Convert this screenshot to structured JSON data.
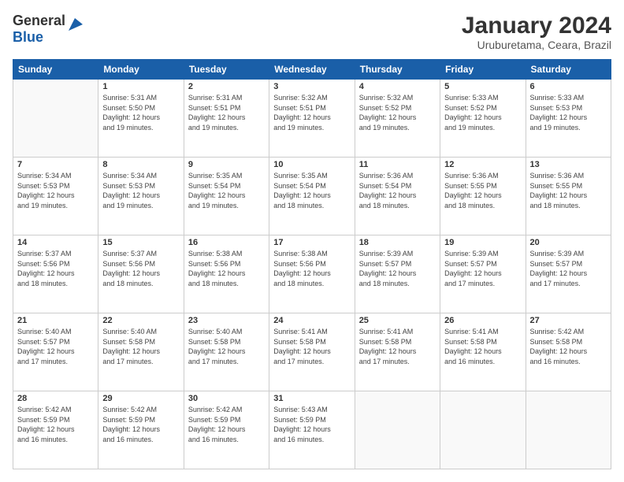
{
  "logo": {
    "line1": "General",
    "line2": "Blue"
  },
  "title": "January 2024",
  "subtitle": "Uruburetama, Ceara, Brazil",
  "weekdays": [
    "Sunday",
    "Monday",
    "Tuesday",
    "Wednesday",
    "Thursday",
    "Friday",
    "Saturday"
  ],
  "weeks": [
    [
      {
        "day": "",
        "info": ""
      },
      {
        "day": "1",
        "info": "Sunrise: 5:31 AM\nSunset: 5:50 PM\nDaylight: 12 hours\nand 19 minutes."
      },
      {
        "day": "2",
        "info": "Sunrise: 5:31 AM\nSunset: 5:51 PM\nDaylight: 12 hours\nand 19 minutes."
      },
      {
        "day": "3",
        "info": "Sunrise: 5:32 AM\nSunset: 5:51 PM\nDaylight: 12 hours\nand 19 minutes."
      },
      {
        "day": "4",
        "info": "Sunrise: 5:32 AM\nSunset: 5:52 PM\nDaylight: 12 hours\nand 19 minutes."
      },
      {
        "day": "5",
        "info": "Sunrise: 5:33 AM\nSunset: 5:52 PM\nDaylight: 12 hours\nand 19 minutes."
      },
      {
        "day": "6",
        "info": "Sunrise: 5:33 AM\nSunset: 5:53 PM\nDaylight: 12 hours\nand 19 minutes."
      }
    ],
    [
      {
        "day": "7",
        "info": "Sunrise: 5:34 AM\nSunset: 5:53 PM\nDaylight: 12 hours\nand 19 minutes."
      },
      {
        "day": "8",
        "info": "Sunrise: 5:34 AM\nSunset: 5:53 PM\nDaylight: 12 hours\nand 19 minutes."
      },
      {
        "day": "9",
        "info": "Sunrise: 5:35 AM\nSunset: 5:54 PM\nDaylight: 12 hours\nand 19 minutes."
      },
      {
        "day": "10",
        "info": "Sunrise: 5:35 AM\nSunset: 5:54 PM\nDaylight: 12 hours\nand 18 minutes."
      },
      {
        "day": "11",
        "info": "Sunrise: 5:36 AM\nSunset: 5:54 PM\nDaylight: 12 hours\nand 18 minutes."
      },
      {
        "day": "12",
        "info": "Sunrise: 5:36 AM\nSunset: 5:55 PM\nDaylight: 12 hours\nand 18 minutes."
      },
      {
        "day": "13",
        "info": "Sunrise: 5:36 AM\nSunset: 5:55 PM\nDaylight: 12 hours\nand 18 minutes."
      }
    ],
    [
      {
        "day": "14",
        "info": "Sunrise: 5:37 AM\nSunset: 5:56 PM\nDaylight: 12 hours\nand 18 minutes."
      },
      {
        "day": "15",
        "info": "Sunrise: 5:37 AM\nSunset: 5:56 PM\nDaylight: 12 hours\nand 18 minutes."
      },
      {
        "day": "16",
        "info": "Sunrise: 5:38 AM\nSunset: 5:56 PM\nDaylight: 12 hours\nand 18 minutes."
      },
      {
        "day": "17",
        "info": "Sunrise: 5:38 AM\nSunset: 5:56 PM\nDaylight: 12 hours\nand 18 minutes."
      },
      {
        "day": "18",
        "info": "Sunrise: 5:39 AM\nSunset: 5:57 PM\nDaylight: 12 hours\nand 18 minutes."
      },
      {
        "day": "19",
        "info": "Sunrise: 5:39 AM\nSunset: 5:57 PM\nDaylight: 12 hours\nand 17 minutes."
      },
      {
        "day": "20",
        "info": "Sunrise: 5:39 AM\nSunset: 5:57 PM\nDaylight: 12 hours\nand 17 minutes."
      }
    ],
    [
      {
        "day": "21",
        "info": "Sunrise: 5:40 AM\nSunset: 5:57 PM\nDaylight: 12 hours\nand 17 minutes."
      },
      {
        "day": "22",
        "info": "Sunrise: 5:40 AM\nSunset: 5:58 PM\nDaylight: 12 hours\nand 17 minutes."
      },
      {
        "day": "23",
        "info": "Sunrise: 5:40 AM\nSunset: 5:58 PM\nDaylight: 12 hours\nand 17 minutes."
      },
      {
        "day": "24",
        "info": "Sunrise: 5:41 AM\nSunset: 5:58 PM\nDaylight: 12 hours\nand 17 minutes."
      },
      {
        "day": "25",
        "info": "Sunrise: 5:41 AM\nSunset: 5:58 PM\nDaylight: 12 hours\nand 17 minutes."
      },
      {
        "day": "26",
        "info": "Sunrise: 5:41 AM\nSunset: 5:58 PM\nDaylight: 12 hours\nand 16 minutes."
      },
      {
        "day": "27",
        "info": "Sunrise: 5:42 AM\nSunset: 5:58 PM\nDaylight: 12 hours\nand 16 minutes."
      }
    ],
    [
      {
        "day": "28",
        "info": "Sunrise: 5:42 AM\nSunset: 5:59 PM\nDaylight: 12 hours\nand 16 minutes."
      },
      {
        "day": "29",
        "info": "Sunrise: 5:42 AM\nSunset: 5:59 PM\nDaylight: 12 hours\nand 16 minutes."
      },
      {
        "day": "30",
        "info": "Sunrise: 5:42 AM\nSunset: 5:59 PM\nDaylight: 12 hours\nand 16 minutes."
      },
      {
        "day": "31",
        "info": "Sunrise: 5:43 AM\nSunset: 5:59 PM\nDaylight: 12 hours\nand 16 minutes."
      },
      {
        "day": "",
        "info": ""
      },
      {
        "day": "",
        "info": ""
      },
      {
        "day": "",
        "info": ""
      }
    ]
  ]
}
